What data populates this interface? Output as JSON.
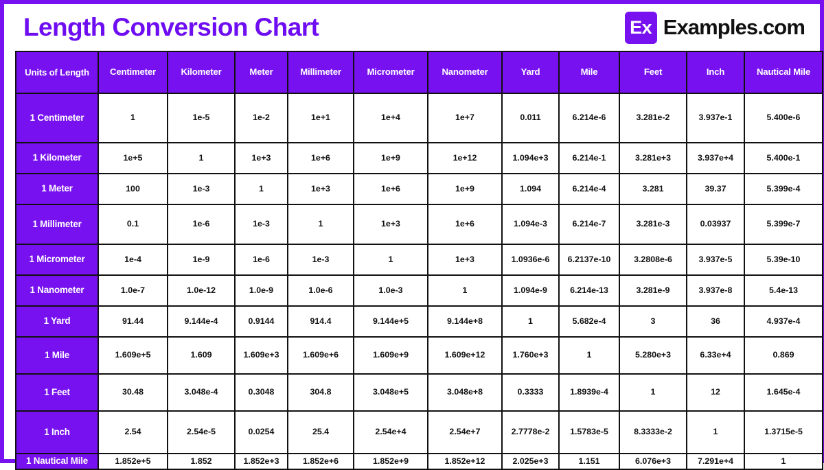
{
  "header": {
    "title": "Length Conversion Chart",
    "brand_mark": "Ex",
    "brand_name": "Examples.com"
  },
  "colors": {
    "accent_purple": "#7711f0",
    "title_purple": "#6e0df2",
    "border_black": "#111111",
    "cell_background": "#ffffff",
    "header_text": "#ffffff"
  },
  "chart_data": {
    "type": "table",
    "title": "Length Conversion Chart",
    "columns": [
      "Units of Length",
      "Centimeter",
      "Kilometer",
      "Meter",
      "Millimeter",
      "Micrometer",
      "Nanometer",
      "Yard",
      "Mile",
      "Feet",
      "Inch",
      "Nautical Mile"
    ],
    "rows": [
      {
        "label": "1 Centimeter",
        "values": [
          "1",
          "1e-5",
          "1e-2",
          "1e+1",
          "1e+4",
          "1e+7",
          "0.011",
          "6.214e-6",
          "3.281e-2",
          "3.937e-1",
          "5.400e-6"
        ]
      },
      {
        "label": "1 Kilometer",
        "values": [
          "1e+5",
          "1",
          "1e+3",
          "1e+6",
          "1e+9",
          "1e+12",
          "1.094e+3",
          "6.214e-1",
          "3.281e+3",
          "3.937e+4",
          "5.400e-1"
        ]
      },
      {
        "label": "1 Meter",
        "values": [
          "100",
          "1e-3",
          "1",
          "1e+3",
          "1e+6",
          "1e+9",
          "1.094",
          "6.214e-4",
          "3.281",
          "39.37",
          "5.399e-4"
        ]
      },
      {
        "label": "1 Millimeter",
        "values": [
          "0.1",
          "1e-6",
          "1e-3",
          "1",
          "1e+3",
          "1e+6",
          "1.094e-3",
          "6.214e-7",
          "3.281e-3",
          "0.03937",
          "5.399e-7"
        ]
      },
      {
        "label": "1 Micrometer",
        "values": [
          "1e-4",
          "1e-9",
          "1e-6",
          "1e-3",
          "1",
          "1e+3",
          "1.0936e-6",
          "6.2137e-10",
          "3.2808e-6",
          "3.937e-5",
          "5.39e-10"
        ]
      },
      {
        "label": "1 Nanometer",
        "values": [
          "1.0e-7",
          "1.0e-12",
          "1.0e-9",
          "1.0e-6",
          "1.0e-3",
          "1",
          "1.094e-9",
          "6.214e-13",
          "3.281e-9",
          "3.937e-8",
          "5.4e-13"
        ]
      },
      {
        "label": "1 Yard",
        "values": [
          "91.44",
          "9.144e-4",
          "0.9144",
          "914.4",
          "9.144e+5",
          "9.144e+8",
          "1",
          "5.682e-4",
          "3",
          "36",
          "4.937e-4"
        ]
      },
      {
        "label": "1 Mile",
        "values": [
          "1.609e+5",
          "1.609",
          "1.609e+3",
          "1.609e+6",
          "1.609e+9",
          "1.609e+12",
          "1.760e+3",
          "1",
          "5.280e+3",
          "6.33e+4",
          "0.869"
        ]
      },
      {
        "label": "1 Feet",
        "values": [
          "30.48",
          "3.048e-4",
          "0.3048",
          "304.8",
          "3.048e+5",
          "3.048e+8",
          "0.3333",
          "1.8939e-4",
          "1",
          "12",
          "1.645e-4"
        ]
      },
      {
        "label": "1 Inch",
        "values": [
          "2.54",
          "2.54e-5",
          "0.0254",
          "25.4",
          "2.54e+4",
          "2.54e+7",
          "2.7778e-2",
          "1.5783e-5",
          "8.3333e-2",
          "1",
          "1.3715e-5"
        ]
      },
      {
        "label": "1 Nautical Mile",
        "values": [
          "1.852e+5",
          "1.852",
          "1.852e+3",
          "1.852e+6",
          "1.852e+9",
          "1.852e+12",
          "2.025e+3",
          "1.151",
          "6.076e+3",
          "7.291e+4",
          "1"
        ]
      }
    ]
  }
}
